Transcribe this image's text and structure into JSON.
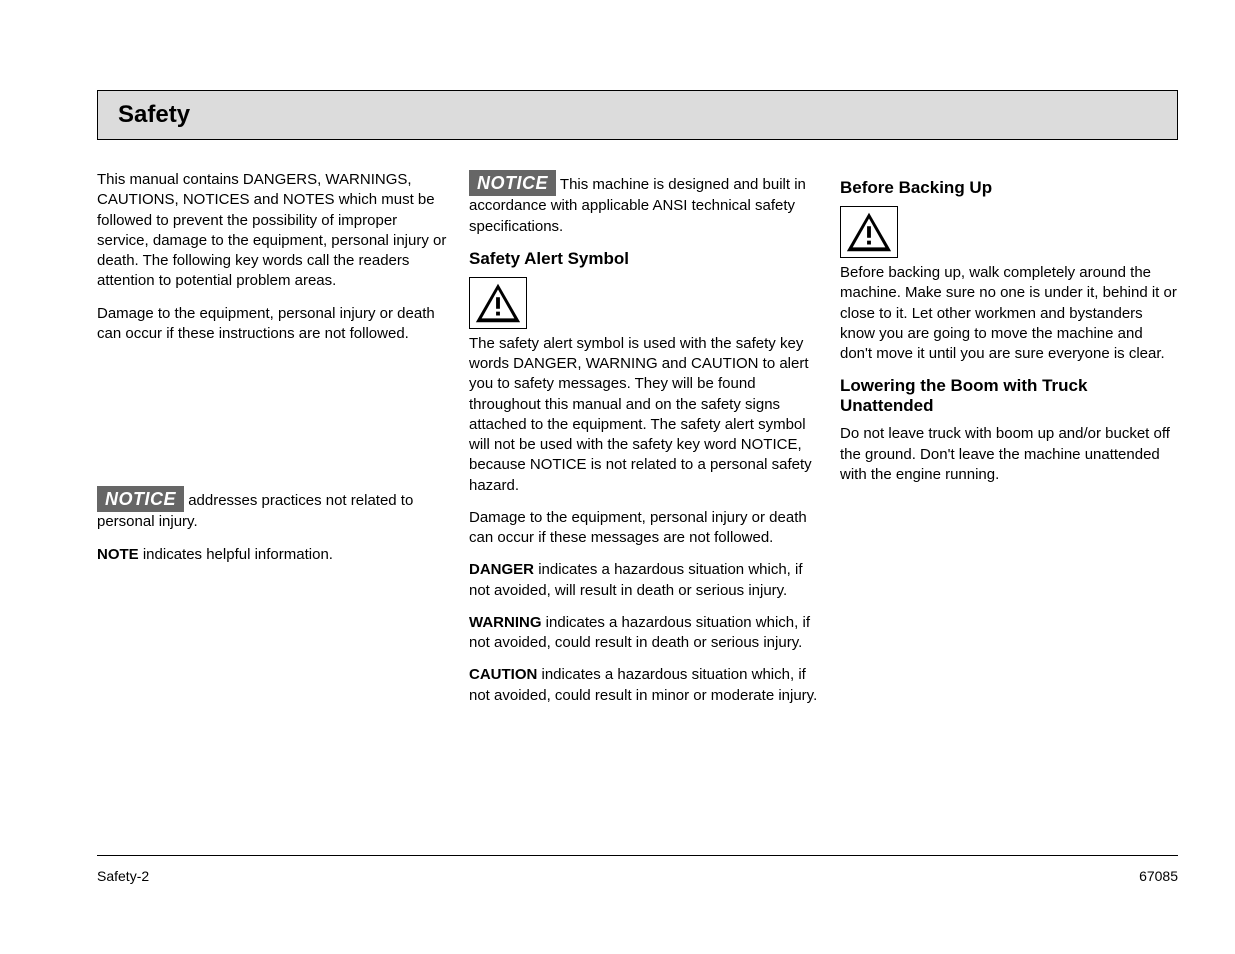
{
  "header": {
    "title": "Safety"
  },
  "left": {
    "p1": "This manual contains DANGERS, WARNINGS, CAUTIONS, NOTICES and NOTES which must be followed to prevent the possibility of improper service, damage to the equipment, personal injury or death. The following key words call the readers attention to potential problem areas.",
    "p2": "Damage to the equipment, personal injury or death can occur if these instructions are not followed.",
    "notice_label": "NOTICE",
    "notice_text": "addresses practices not related to personal injury.",
    "note_label": "NOTE",
    "note_text": "indicates helpful information."
  },
  "mid": {
    "notice_label": "NOTICE",
    "notice_text": "This machine is designed and built in accordance with applicable ANSI technical safety specifications.",
    "alert_heading": "Safety Alert Symbol",
    "alert_p1": "The safety alert symbol is used with the safety key words DANGER, WARNING and CAUTION to alert you to safety messages. They will be found throughout this manual and on the safety signs attached to the equipment. The safety alert symbol will not be used with the safety key word NOTICE, because NOTICE is not related to a personal safety hazard.",
    "alert_p2": "Damage to the equipment, personal injury or death can occur if these messages are not followed.",
    "danger_label": "DANGER",
    "danger_text": "indicates a hazardous situation which, if not avoided, will result in death or serious injury.",
    "warning_label": "WARNING",
    "warning_text": "indicates a hazardous situation which, if not avoided, could result in death or serious injury.",
    "caution_label": "CAUTION",
    "caution_text": "indicates a hazardous situation which, if not avoided, could result in minor or moderate injury."
  },
  "right": {
    "back_heading": "Before Backing Up",
    "back_p1": "Before backing up, walk completely around the machine. Make sure no one is under it, behind it or close to it. Let other workmen and bystanders know you are going to move the machine and don't move it until you are sure everyone is clear.",
    "unattended_heading": "Lowering the Boom with Truck Unattended",
    "unattended_p1": "Do not leave truck with boom up and/or bucket off the ground. Don't leave the machine unattended with the engine running."
  },
  "footer": {
    "left": "Safety-2",
    "right": "67085"
  }
}
